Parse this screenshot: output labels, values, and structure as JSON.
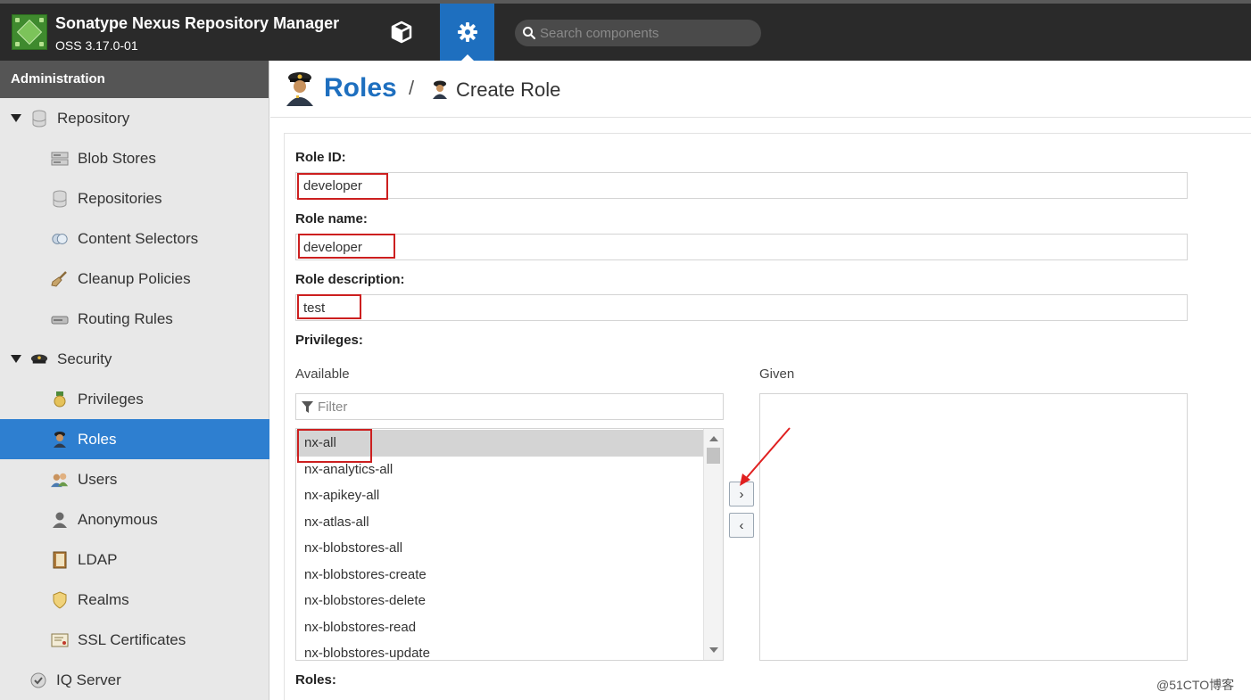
{
  "app": {
    "title": "Sonatype Nexus Repository Manager",
    "version": "OSS 3.17.0-01"
  },
  "topbar": {
    "browse_icon": "cube-icon",
    "admin_icon": "gear-icon",
    "search_placeholder": "Search components",
    "accent_color": "#1e6fbf"
  },
  "sidebar": {
    "header": "Administration",
    "items": [
      {
        "label": "Repository",
        "icon": "database-icon"
      },
      {
        "label": "Blob Stores",
        "icon": "server-icon"
      },
      {
        "label": "Repositories",
        "icon": "database-icon"
      },
      {
        "label": "Content Selectors",
        "icon": "selector-icon"
      },
      {
        "label": "Cleanup Policies",
        "icon": "broom-icon"
      },
      {
        "label": "Routing Rules",
        "icon": "router-icon"
      },
      {
        "label": "Security",
        "icon": "police-hat-icon"
      },
      {
        "label": "Privileges",
        "icon": "medal-icon"
      },
      {
        "label": "Roles",
        "icon": "officer-icon"
      },
      {
        "label": "Users",
        "icon": "users-icon"
      },
      {
        "label": "Anonymous",
        "icon": "anonymous-user-icon"
      },
      {
        "label": "LDAP",
        "icon": "address-book-icon"
      },
      {
        "label": "Realms",
        "icon": "shield-icon"
      },
      {
        "label": "SSL Certificates",
        "icon": "certificate-icon"
      },
      {
        "label": "IQ Server",
        "icon": "iq-server-icon"
      }
    ],
    "active_color": "#2e7fd0"
  },
  "page": {
    "title": "Roles",
    "separator": "/",
    "breadcrumb": "Create Role"
  },
  "form": {
    "role_id_label": "Role ID:",
    "role_id_value": "developer",
    "role_name_label": "Role name:",
    "role_name_value": "developer",
    "role_desc_label": "Role description:",
    "role_desc_value": "test",
    "privileges_label": "Privileges:",
    "available_label": "Available",
    "given_label": "Given",
    "filter_placeholder": "Filter",
    "available": [
      "nx-all",
      "nx-analytics-all",
      "nx-apikey-all",
      "nx-atlas-all",
      "nx-blobstores-all",
      "nx-blobstores-create",
      "nx-blobstores-delete",
      "nx-blobstores-read",
      "nx-blobstores-update"
    ],
    "selected": "nx-all",
    "move_right": "›",
    "move_left": "‹",
    "roles_label": "Roles:",
    "highlight_color": "#cc1f1f"
  },
  "watermark": "@51CTO博客"
}
